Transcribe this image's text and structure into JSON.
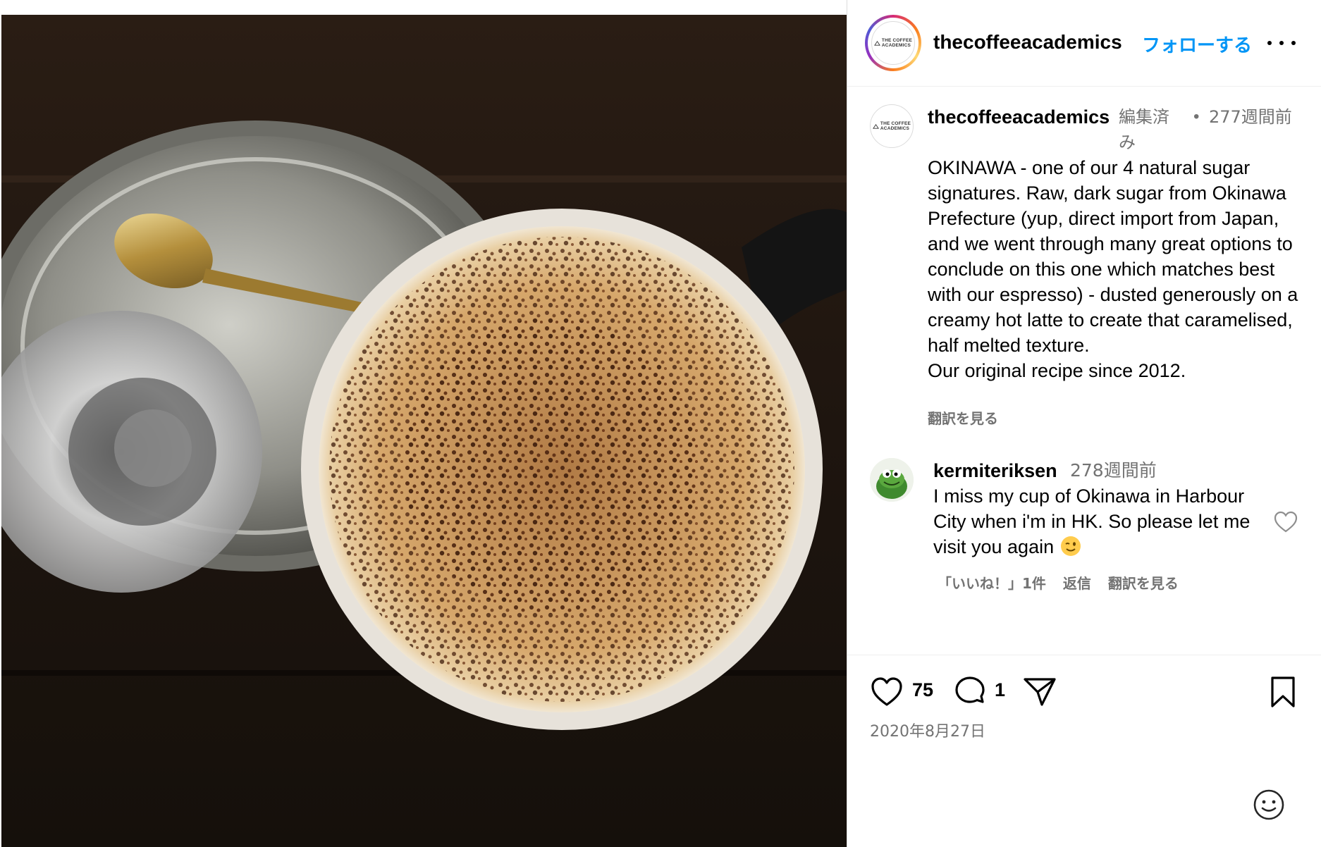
{
  "post": {
    "username": "thecoffeeacademics",
    "follow_label": "フォローする",
    "more_icon": "more-horizontal-icon",
    "logo_text_line1": "THE COFFEE",
    "logo_text_line2": "ACADEMICS"
  },
  "caption": {
    "username": "thecoffeeacademics",
    "edited_label": "編集済み",
    "separator": "•",
    "time_ago": "277週間前",
    "lines": [
      "OKINAWA - one of our 4 natural sugar signatures. Raw, dark sugar from Okinawa Prefecture (yup, direct import from Japan, and we went through many great options to conclude on this one which matches best with our espresso) - dusted generously on a creamy hot latte to create that caramelised, half melted texture.",
      "Our original recipe since 2012."
    ],
    "translate_label": "翻訳を見る"
  },
  "comment": {
    "username": "kermiteriksen",
    "time_ago": "278週間前",
    "text": "I miss my cup of Okinawa in Harbour City when i'm in HK. So please let me visit you again",
    "emoji": "winking-face",
    "likes_label": "「いいね！」1件",
    "reply_label": "返信",
    "translate_label": "翻訳を見る"
  },
  "actions": {
    "like_count": "75",
    "comment_count": "1",
    "date": "2020年8月27日"
  },
  "colors": {
    "link_blue": "#0095f6",
    "secondary_text": "#737373",
    "border": "#dbdbdb"
  }
}
